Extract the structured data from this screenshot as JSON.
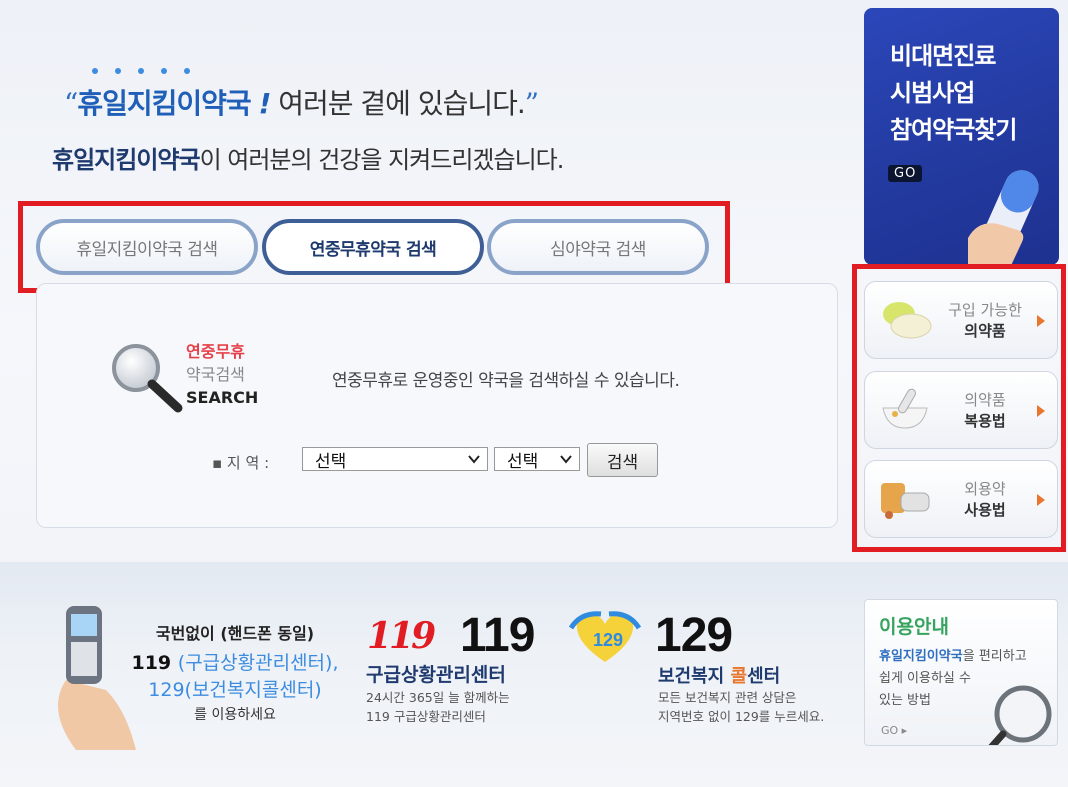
{
  "headline": {
    "open_quote": "“",
    "brand": "휴일지킴이약국",
    "bang": "!",
    "rest": " 여러분 곁에 있습니다.",
    "close_quote": "”"
  },
  "subline": {
    "brand": "휴일지킴이약국",
    "rest": "이 여러분의 건강을 지켜드리겠습니다."
  },
  "tabs": [
    {
      "label": "휴일지킴이약국 검색",
      "active": false
    },
    {
      "label": "연중무휴약국 검색",
      "active": true
    },
    {
      "label": "심야약국 검색",
      "active": false
    }
  ],
  "search": {
    "title_red": "연중무휴",
    "title_gray": "약국검색",
    "title_en": "SEARCH",
    "description": "연중무휴로 운영중인 약국을 검색하실 수 있습니다.",
    "region_label": "▪ 지 역 :",
    "select1": "선택",
    "select2": "선택",
    "button": "검색"
  },
  "banner": {
    "line1": "비대면진료",
    "line2": "시범사업",
    "line3": "참여약국찾기",
    "go": "GO",
    "bg_color": "#263fab"
  },
  "side_menu": [
    {
      "line1": "구입 가능한",
      "line2": "의약품",
      "icon": "pill-icon"
    },
    {
      "line1": "의약품",
      "line2": "복용법",
      "icon": "mortar-icon"
    },
    {
      "line1": "외용약",
      "line2": "사용법",
      "icon": "ointment-icon"
    }
  ],
  "phone_info": {
    "line1": "국번없이 (핸드폰 동일)",
    "line2_num": "119",
    "line2_rest": "(구급상황관리센터),",
    "line3": "129(보건복지콜센터)",
    "line4": "를 이용하세요"
  },
  "emergency119": {
    "logo": "119",
    "number": "119",
    "title": "구급상황관리센터",
    "desc1": "24시간 365일 늘 함께하는",
    "desc2": "119 구급상황관리센터"
  },
  "welfare129": {
    "number": "129",
    "title_a": "보건복지 ",
    "title_hl": "콜",
    "title_b": "센터",
    "desc1": "모든 보건복지 관련 상담은",
    "desc2": "지역번호 없이 129를 누르세요."
  },
  "guide": {
    "title": "이용안내",
    "brand": "휴일지킴이약국",
    "desc1": "을 편리하고",
    "desc2": "쉽게 이용하실 수",
    "desc3": "있는 방법",
    "go": "GO ▸"
  },
  "colors": {
    "highlight_red": "#e11d23",
    "brand_blue": "#1f5fb8",
    "navy": "#1f3a6e",
    "accent_orange": "#e8762c",
    "guide_green": "#36a45f"
  }
}
